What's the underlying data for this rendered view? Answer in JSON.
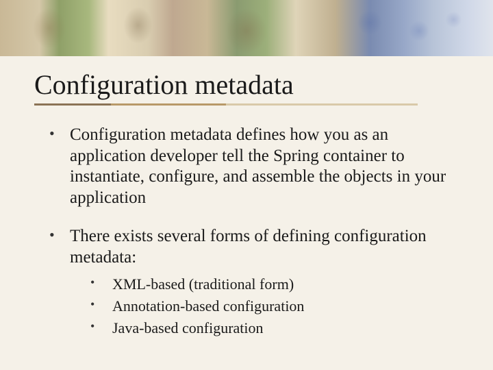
{
  "title": "Configuration metadata",
  "bullets": [
    {
      "text": "Configuration metadata defines how you as an application developer tell the Spring container to instantiate, configure, and assemble the objects in your application"
    },
    {
      "text": "There exists several forms of defining configuration metadata:",
      "sub": [
        "XML-based  (traditional form)",
        "Annotation-based configuration",
        "Java-based configuration"
      ]
    }
  ]
}
